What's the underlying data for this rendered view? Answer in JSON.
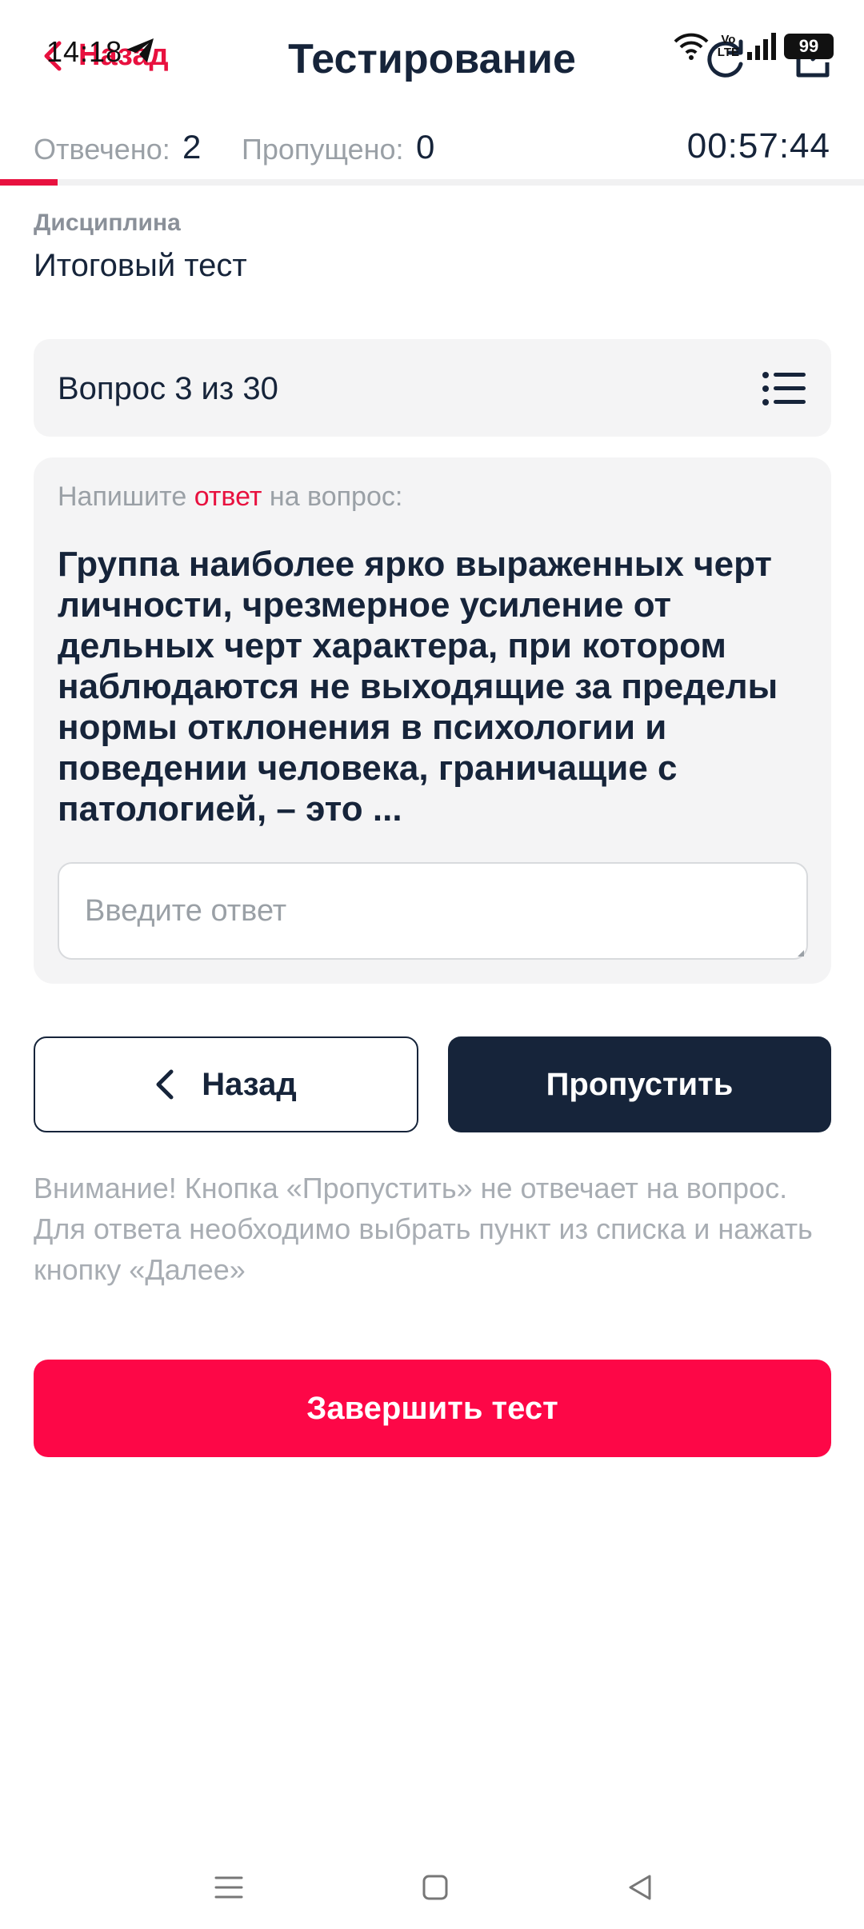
{
  "status_bar": {
    "time": "14:18",
    "volte_top": "Vo",
    "volte_bottom": "LTE",
    "battery": "99"
  },
  "header": {
    "back_label": "Назад",
    "title": "Тестирование"
  },
  "progress": {
    "answered_label": "Отвечено:",
    "answered_value": "2",
    "skipped_label": "Пропущено:",
    "skipped_value": "0",
    "timer": "00:57:44",
    "fraction": 0.067
  },
  "discipline": {
    "label": "Дисциплина",
    "value": "Итоговый тест"
  },
  "question": {
    "counter": "Вопрос 3 из 30",
    "prompt_before": "Напишите ",
    "prompt_accent": "ответ",
    "prompt_after": " на вопрос:",
    "text": "Группа наиболее ярко выраженных черт личности, чрезмерное усиление от дельных черт характера, при котором наблюдаются не выходящие за пределы нормы отклонения в психологии и поведении человека, граничащие с патологией, – это ...",
    "answer_placeholder": "Введите ответ",
    "answer_value": ""
  },
  "buttons": {
    "back": "Назад",
    "skip": "Пропустить",
    "finish": "Завершить тест"
  },
  "notice": "Внимание! Кнопка «Пропустить» не отвечает на вопрос. Для ответа необходимо выбрать пункт из списка и нажать кнопку «Далее»",
  "colors": {
    "accent": "#e8113f",
    "finish_button": "#fd0747",
    "primary_dark": "#16243a",
    "muted_text": "#9aa0a6"
  },
  "icons": {
    "back": "chevron-left-icon",
    "refresh": "refresh-icon",
    "exit": "exit-icon",
    "question_list": "list-icon"
  }
}
